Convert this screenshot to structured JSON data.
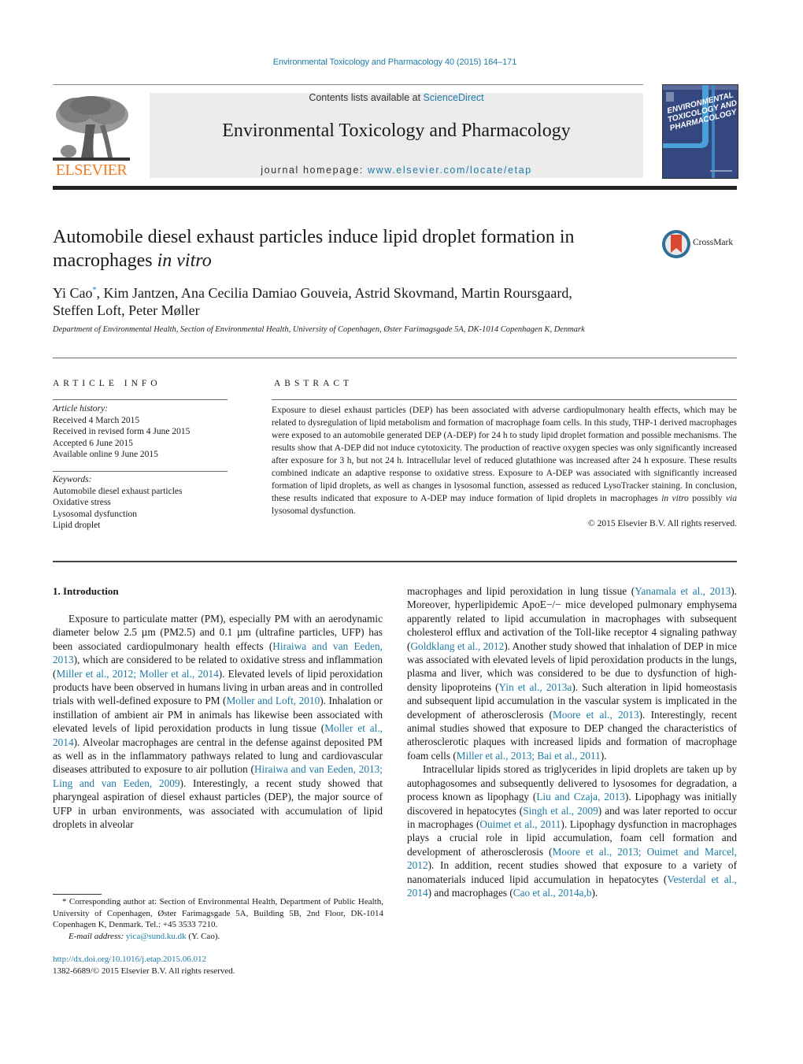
{
  "header": {
    "journal_citation": "Environmental Toxicology and Pharmacology 40 (2015) 164–171",
    "contents_prefix": "Contents lists available at ",
    "contents_link": "ScienceDirect",
    "journal_title": "Environmental Toxicology and Pharmacology",
    "homepage_prefix": "journal homepage: ",
    "homepage_link": "www.elsevier.com/locate/etap",
    "publisher_logo_text": "ELSEVIER",
    "cover_title_lines": [
      "ENVIRONMENTAL",
      "TOXICOLOGY AND",
      "PHARMACOLOGY"
    ],
    "brand_color": "#f47b20",
    "link_color": "#1e7ba6"
  },
  "article": {
    "title_main": "Automobile diesel exhaust particles induce lipid droplet formation in macrophages ",
    "title_italic": "in vitro",
    "crossmark_label": "CrossMark",
    "authors": [
      {
        "name": "Yi Cao",
        "mark": "*"
      },
      {
        "name": "Kim Jantzen"
      },
      {
        "name": "Ana Cecilia Damiao Gouveia"
      },
      {
        "name": "Astrid Skovmand"
      },
      {
        "name": "Martin Roursgaard"
      },
      {
        "name": "Steffen Loft"
      },
      {
        "name": "Peter Møller"
      }
    ],
    "authors_line1_tail": ", Kim Jantzen, Ana Cecilia Damiao Gouveia, Astrid Skovmand, Martin Roursgaard,",
    "authors_line2": "Steffen Loft, Peter Møller",
    "affiliation": "Department of Environmental Health, Section of Environmental Health, University of Copenhagen, Øster Farimagsgade 5A, DK-1014 Copenhagen K, Denmark"
  },
  "article_info": {
    "heading": "ARTICLE INFO",
    "history_label": "Article history:",
    "history": [
      "Received 4 March 2015",
      "Received in revised form 4 June 2015",
      "Accepted 6 June 2015",
      "Available online 9 June 2015"
    ],
    "keywords_label": "Keywords:",
    "keywords": [
      "Automobile diesel exhaust particles",
      "Oxidative stress",
      "Lysosomal dysfunction",
      "Lipid droplet"
    ]
  },
  "abstract": {
    "heading": "ABSTRACT",
    "text_part1": "Exposure to diesel exhaust particles (DEP) has been associated with adverse cardiopulmonary health effects, which may be related to dysregulation of lipid metabolism and formation of macrophage foam cells. In this study, THP-1 derived macrophages were exposed to an automobile generated DEP (A-DEP) for 24 h to study lipid droplet formation and possible mechanisms. The results show that A-DEP did not induce cytotoxicity. The production of reactive oxygen species was only significantly increased after exposure for 3 h, but not 24 h. Intracellular level of reduced glutathione was increased after 24 h exposure. These results combined indicate an adaptive response to oxidative stress. Exposure to A-DEP was associated with significantly increased formation of lipid droplets, as well as changes in lysosomal function, assessed as reduced LysoTracker staining. In conclusion, these results indicated that exposure to A-DEP may induce formation of lipid droplets in macrophages ",
    "italic1": "in vitro",
    "text_part2": " possibly ",
    "italic2": "via",
    "text_part3": " lysosomal dysfunction.",
    "copyright": "© 2015 Elsevier B.V. All rights reserved."
  },
  "body": {
    "section_heading": "1.  Introduction",
    "left_col": [
      {
        "t": "Exposure to particulate matter (PM), especially PM with an aerodynamic diameter below 2.5 µm (PM2.5) and 0.1 µm (ultrafine particles, UFP) has been associated cardiopulmonary health effects ("
      },
      {
        "l": "Hiraiwa and van Eeden, 2013"
      },
      {
        "t": "), which are considered to be related to oxidative stress and inflammation ("
      },
      {
        "l": "Miller et al., 2012; Moller et al., 2014"
      },
      {
        "t": "). Elevated levels of lipid peroxidation products have been observed in humans living in urban areas and in controlled trials with well-defined exposure to PM ("
      },
      {
        "l": "Moller and Loft, 2010"
      },
      {
        "t": "). Inhalation or instillation of ambient air PM in animals has likewise been associated with elevated levels of lipid peroxidation products in lung tissue ("
      },
      {
        "l": "Moller et al., 2014"
      },
      {
        "t": "). Alveolar macrophages are central in the defense against deposited PM as well as in the inflammatory pathways related to lung and cardiovascular diseases attributed to exposure to air pollution ("
      },
      {
        "l": "Hiraiwa and van Eeden, 2013; Ling and van Eeden, 2009"
      },
      {
        "t": "). Interestingly, a recent study showed that pharyngeal aspiration of diesel exhaust particles (DEP), the major source of UFP in urban environments, was associated with accumulation of lipid droplets in alveolar"
      }
    ],
    "right_col_p1": [
      {
        "t": "macrophages and lipid peroxidation in lung tissue ("
      },
      {
        "l": "Yanamala et al., 2013"
      },
      {
        "t": "). Moreover, hyperlipidemic ApoE−/− mice developed pulmonary emphysema apparently related to lipid accumulation in macrophages with subsequent cholesterol efflux and activation of the Toll-like receptor 4 signaling pathway ("
      },
      {
        "l": "Goldklang et al., 2012"
      },
      {
        "t": "). Another study showed that inhalation of DEP in mice was associated with elevated levels of lipid peroxidation products in the lungs, plasma and liver, which was considered to be due to dysfunction of high-density lipoproteins ("
      },
      {
        "l": "Yin et al., 2013a"
      },
      {
        "t": "). Such alteration in lipid homeostasis and subsequent lipid accumulation in the vascular system is implicated in the development of atherosclerosis ("
      },
      {
        "l": "Moore et al., 2013"
      },
      {
        "t": "). Interestingly, recent animal studies showed that exposure to DEP changed the characteristics of atherosclerotic plaques with increased lipids and formation of macrophage foam cells ("
      },
      {
        "l": "Miller et al., 2013; Bai et al., 2011"
      },
      {
        "t": ")."
      }
    ],
    "right_col_p2": [
      {
        "t": "Intracellular lipids stored as triglycerides in lipid droplets are taken up by autophagosomes and subsequently delivered to lysosomes for degradation, a process known as lipophagy ("
      },
      {
        "l": "Liu and Czaja, 2013"
      },
      {
        "t": "). Lipophagy was initially discovered in hepatocytes ("
      },
      {
        "l": "Singh et al., 2009"
      },
      {
        "t": ") and was later reported to occur in macrophages ("
      },
      {
        "l": "Ouimet et al., 2011"
      },
      {
        "t": "). Lipophagy dysfunction in macrophages plays a crucial role in lipid accumulation, foam cell formation and development of atherosclerosis ("
      },
      {
        "l": "Moore et al., 2013; Ouimet and Marcel, 2012"
      },
      {
        "t": "). In addition, recent studies showed that exposure to a variety of nanomaterials induced lipid accumulation in hepatocytes ("
      },
      {
        "l": "Vesterdal et al., 2014"
      },
      {
        "t": ") and macrophages ("
      },
      {
        "l": "Cao et al., 2014a,b"
      },
      {
        "t": ")."
      }
    ]
  },
  "footnote": {
    "marker": "*",
    "text": " Corresponding author at: Section of Environmental Health, Department of Public Health, University of Copenhagen, Øster Farimagsgade 5A, Building 5B, 2nd Floor, DK-1014 Copenhagen K, Denmark. Tel.: +45 3533 7210.",
    "email_label": "E-mail address: ",
    "email": "yica@sund.ku.dk",
    "email_suffix": " (Y. Cao).",
    "doi": "http://dx.doi.org/10.1016/j.etap.2015.06.012",
    "issn_line": "1382-6689/© 2015 Elsevier B.V. All rights reserved."
  }
}
